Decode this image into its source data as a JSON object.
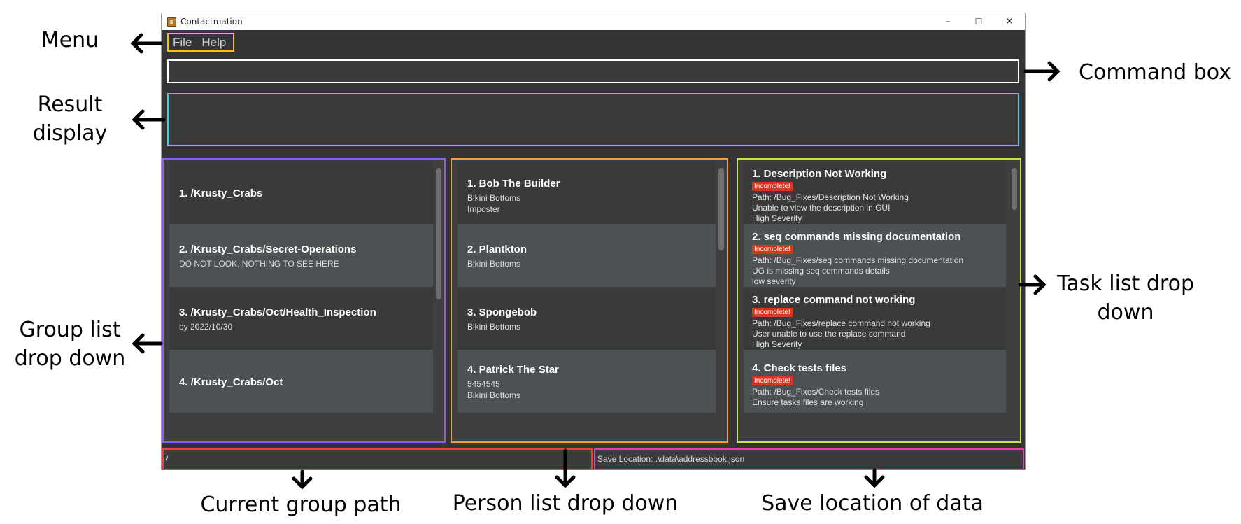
{
  "window": {
    "title": "Contactmation",
    "controls": {
      "minimize": "–",
      "maximize": "☐",
      "close": "✕"
    }
  },
  "menu": {
    "items": [
      "File",
      "Help"
    ]
  },
  "command_box": {
    "value": ""
  },
  "result_display": {
    "text": ""
  },
  "groups": [
    {
      "title": "1.  /Krusty_Crabs",
      "sub": ""
    },
    {
      "title": "2.  /Krusty_Crabs/Secret-Operations",
      "sub": "DO NOT LOOK, NOTHING TO SEE HERE"
    },
    {
      "title": "3.  /Krusty_Crabs/Oct/Health_Inspection",
      "sub": "by 2022/10/30"
    },
    {
      "title": "4.  /Krusty_Crabs/Oct",
      "sub": ""
    }
  ],
  "persons": [
    {
      "title": "1.  Bob The Builder",
      "lines": [
        "Bikini Bottoms",
        "Imposter"
      ]
    },
    {
      "title": "2.  Plantkton",
      "lines": [
        "Bikini Bottoms"
      ]
    },
    {
      "title": "3.  Spongebob",
      "lines": [
        "Bikini Bottoms"
      ]
    },
    {
      "title": "4.  Patrick The Star",
      "lines": [
        "5454545",
        "Bikini Bottoms"
      ]
    }
  ],
  "tasks": [
    {
      "title": "1.  Description Not Working",
      "badge": "Incomplete!",
      "path": "Path: /Bug_Fixes/Description Not Working",
      "desc": "Unable to view the description in GUI",
      "severity": "High Severity"
    },
    {
      "title": "2.  seq commands missing documentation",
      "badge": "Incomplete!",
      "path": "Path: /Bug_Fixes/seq commands missing documentation",
      "desc": "UG is missing seq commands details",
      "severity": "low severity"
    },
    {
      "title": "3.  replace command not working",
      "badge": "Incomplete!",
      "path": "Path: /Bug_Fixes/replace command not working",
      "desc": "User unable to use the replace command",
      "severity": "High Severity"
    },
    {
      "title": "4.  Check tests files",
      "badge": "Incomplete!",
      "path": "Path: /Bug_Fixes/Check tests files",
      "desc": "Ensure tasks files are working",
      "severity": ""
    }
  ],
  "status": {
    "current_path": "/",
    "save_location": "Save Location: .\\data\\addressbook.json"
  },
  "annotations": {
    "menu": "Menu",
    "result_display": "Result\ndisplay",
    "group_list": "Group list\ndrop down",
    "command_box": "Command box",
    "task_list": "Task list drop\ndown",
    "current_group_path": "Current group path",
    "person_list": "Person list drop down",
    "save_location": "Save location of data"
  },
  "colors": {
    "menu_border": "#f5c400",
    "command_border": "#ffffff",
    "result_border": "#38d6e3",
    "group_border": "#8b5cf6",
    "person_border": "#f59e3b",
    "task_border": "#c8e052",
    "path_border": "#e8413a",
    "save_border": "#e83fb0",
    "badge": "#d4381f"
  }
}
